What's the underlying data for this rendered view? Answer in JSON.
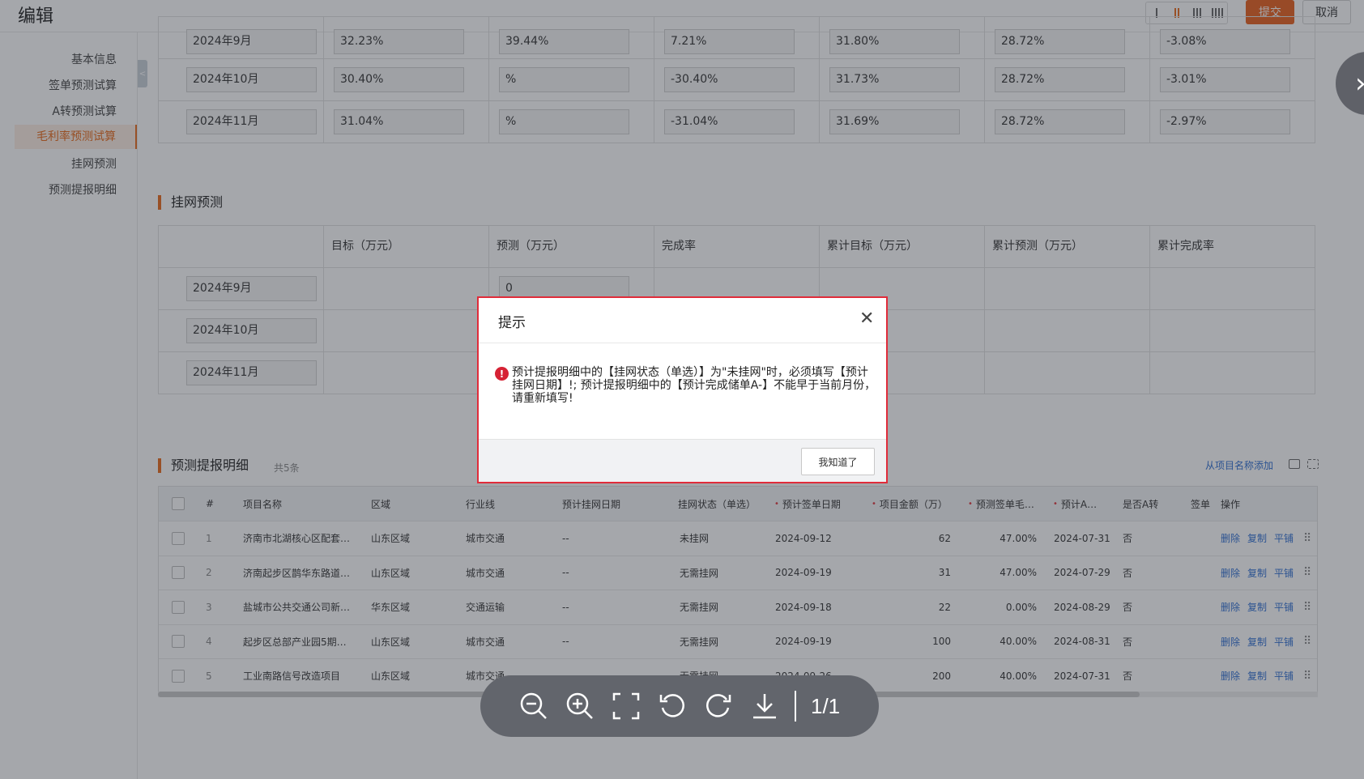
{
  "header": {
    "title": "编辑",
    "submit_label": "提交",
    "cancel_label": "取消"
  },
  "sidebar": {
    "items": [
      {
        "label": "基本信息"
      },
      {
        "label": "签单预测试算"
      },
      {
        "label": "A转预测试算"
      },
      {
        "label": "毛利率预测试算",
        "active": true
      },
      {
        "label": "挂网预测"
      },
      {
        "label": "预测提报明细"
      }
    ]
  },
  "margin_table": {
    "rows": [
      {
        "month": "2024年9月",
        "values": [
          "32.23%",
          "39.44%",
          "7.21%",
          "31.80%",
          "28.72%",
          "-3.08%"
        ]
      },
      {
        "month": "2024年10月",
        "values": [
          "30.40%",
          "%",
          "-30.40%",
          "31.73%",
          "28.72%",
          "-3.01%"
        ]
      },
      {
        "month": "2024年11月",
        "values": [
          "31.04%",
          "%",
          "-31.04%",
          "31.69%",
          "28.72%",
          "-2.97%"
        ]
      }
    ]
  },
  "network_section": {
    "title": "挂网预测",
    "headers": [
      "",
      "目标（万元）",
      "预测（万元）",
      "完成率",
      "累计目标（万元）",
      "累计预测（万元）",
      "累计完成率"
    ],
    "rows": [
      {
        "month": "2024年9月",
        "forecast": "0"
      },
      {
        "month": "2024年10月",
        "forecast": ""
      },
      {
        "month": "2024年11月",
        "forecast": ""
      }
    ]
  },
  "detail_section": {
    "title": "预测提报明细",
    "count": "共5条",
    "add_link": "从项目名称添加",
    "headers": [
      "#",
      "项目名称",
      "区域",
      "行业线",
      "预计挂网日期",
      "挂网状态（单选）",
      "预计签单日期",
      "项目金额（万）",
      "预测签单毛…",
      "预计A…",
      "是否A转",
      "签单",
      "操作"
    ],
    "rows": [
      {
        "no": "1",
        "name": "济南市北湖核心区配套…",
        "region": "山东区域",
        "industry": "城市交通",
        "net_date": "--",
        "status": "未挂网",
        "sign_date": "2024-09-12",
        "amount": "62",
        "margin": "47.00%",
        "a_date": "2024-07-31",
        "is_a": "否"
      },
      {
        "no": "2",
        "name": "济南起步区鹊华东路道…",
        "region": "山东区域",
        "industry": "城市交通",
        "net_date": "--",
        "status": "无需挂网",
        "sign_date": "2024-09-19",
        "amount": "31",
        "margin": "47.00%",
        "a_date": "2024-07-29",
        "is_a": "否"
      },
      {
        "no": "3",
        "name": "盐城市公共交通公司新…",
        "region": "华东区域",
        "industry": "交通运输",
        "net_date": "--",
        "status": "无需挂网",
        "sign_date": "2024-09-18",
        "amount": "22",
        "margin": "0.00%",
        "a_date": "2024-08-29",
        "is_a": "否"
      },
      {
        "no": "4",
        "name": "起步区总部产业园5期…",
        "region": "山东区域",
        "industry": "城市交通",
        "net_date": "--",
        "status": "无需挂网",
        "sign_date": "2024-09-19",
        "amount": "100",
        "margin": "40.00%",
        "a_date": "2024-08-31",
        "is_a": "否"
      },
      {
        "no": "5",
        "name": "工业南路信号改造项目",
        "region": "山东区域",
        "industry": "城市交通",
        "net_date": "--",
        "status": "无需挂网",
        "sign_date": "2024-09-26",
        "amount": "200",
        "margin": "40.00%",
        "a_date": "2024-07-31",
        "is_a": "否"
      }
    ],
    "ops": [
      "删除",
      "复制",
      "平铺"
    ]
  },
  "dialog": {
    "title": "提示",
    "message": "预计提报明细中的【挂网状态（单选）】为\"未挂网\"时，必须填写【预计挂网日期】!; 预计提报明细中的【预计完成储单A-】不能早于当前月份，请重新填写!",
    "ok_label": "我知道了"
  },
  "viewer": {
    "page_indicator": "1/1"
  },
  "colors": {
    "accent": "#e86a1a",
    "link": "#2f6fd3",
    "error": "#d62234"
  }
}
